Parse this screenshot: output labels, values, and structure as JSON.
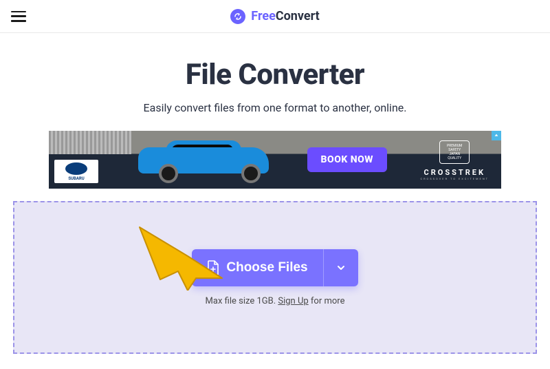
{
  "header": {
    "logo_free": "Free",
    "logo_convert": "Convert"
  },
  "main": {
    "title": "File Converter",
    "subtitle": "Easily convert files from one format to another, online."
  },
  "ad": {
    "brand_badge": "SUBARU",
    "cta": "BOOK NOW",
    "japan_line1": "PREMIUM",
    "japan_line2": "SAFETY",
    "japan_line3": "JAPAN",
    "japan_line4": "QUALITY",
    "model": "CROSSTREK",
    "tagline": "CROSSOVER TO EXCITEMENT"
  },
  "dropzone": {
    "choose_files_label": "Choose Files",
    "hint_prefix": "Max file size 1GB. ",
    "hint_link": "Sign Up",
    "hint_suffix": " for more"
  }
}
